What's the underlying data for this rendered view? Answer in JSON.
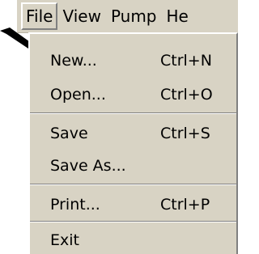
{
  "menubar": {
    "items": [
      {
        "label": "File"
      },
      {
        "label": "View"
      },
      {
        "label": "Pump"
      },
      {
        "label": "He"
      }
    ]
  },
  "file_menu": {
    "items": [
      {
        "label": "New...",
        "shortcut": "Ctrl+N"
      },
      {
        "label": "Open...",
        "shortcut": "Ctrl+O"
      },
      {
        "label": "Save",
        "shortcut": "Ctrl+S"
      },
      {
        "label": "Save As...",
        "shortcut": ""
      },
      {
        "label": "Print...",
        "shortcut": "Ctrl+P"
      },
      {
        "label": "Exit",
        "shortcut": ""
      }
    ]
  },
  "colors": {
    "menu_background": "#d8d3c4",
    "highlight": "#ffffff",
    "shadow": "#808080",
    "arrow": "#000000"
  },
  "icons": {
    "pointer": "pointer-arrow-icon"
  }
}
